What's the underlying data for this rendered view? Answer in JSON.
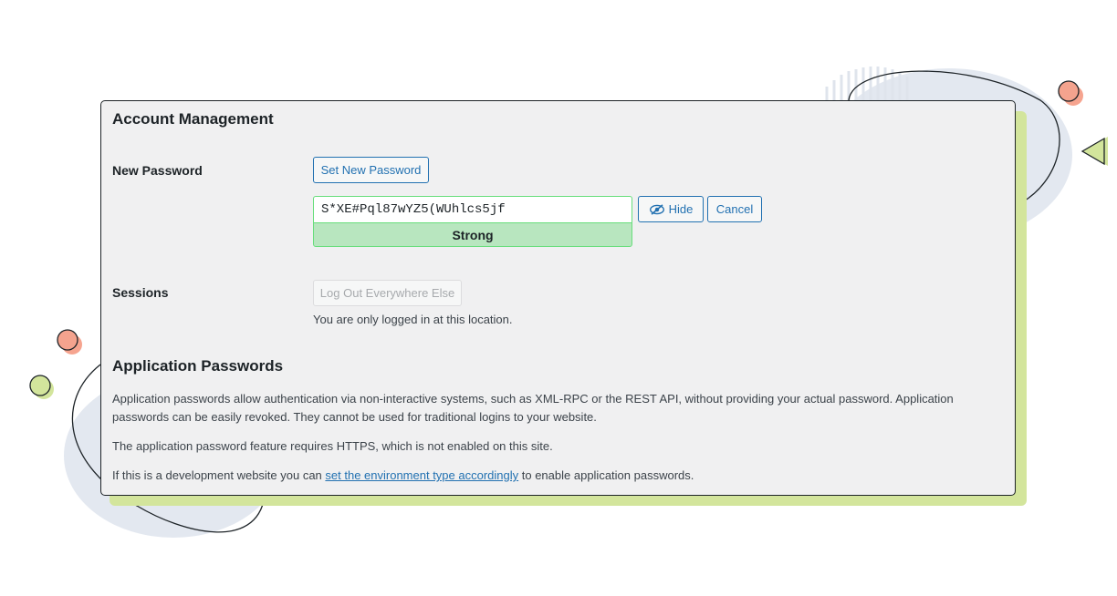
{
  "account": {
    "heading": "Account Management",
    "new_password_label": "New Password",
    "set_new_password_button": "Set New Password",
    "password_value": "S*XE#Pql87wYZ5(WUhlcs5jf",
    "strength_label": "Strong",
    "hide_button": "Hide",
    "cancel_button": "Cancel",
    "sessions_label": "Sessions",
    "logout_button": "Log Out Everywhere Else",
    "sessions_description": "You are only logged in at this location."
  },
  "app_passwords": {
    "heading": "Application Passwords",
    "paragraph1": "Application passwords allow authentication via non-interactive systems, such as XML-RPC or the REST API, without providing your actual password. Application passwords can be easily revoked. They cannot be used for traditional logins to your website.",
    "paragraph2": "The application password feature requires HTTPS, which is not enabled on this site.",
    "paragraph3_prefix": "If this is a development website you can ",
    "paragraph3_link": "set the environment type accordingly",
    "paragraph3_suffix": " to enable application passwords."
  },
  "icons": {
    "hide": "eye-slash-icon"
  },
  "colors": {
    "accent": "#2271b1",
    "strength_bg": "#b8e6bf",
    "strength_border": "#68de7c",
    "panel_bg": "#f0f0f1",
    "shadow": "#d3e59c"
  }
}
